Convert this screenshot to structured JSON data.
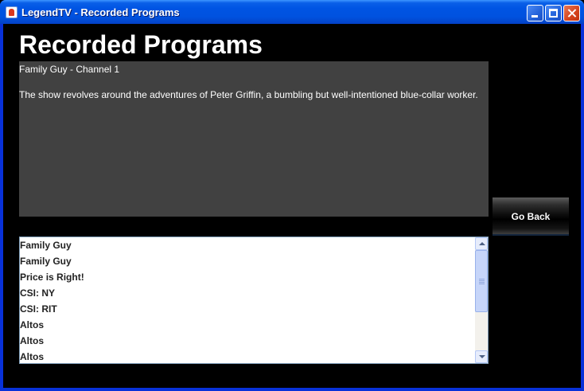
{
  "window": {
    "title": "LegendTV - Recorded Programs",
    "controls": [
      "minimize-icon",
      "maximize-icon",
      "close-icon"
    ]
  },
  "page": {
    "title": "Recorded Programs"
  },
  "details": {
    "heading": "Family Guy - Channel 1",
    "description": "The show revolves around the adventures of Peter Griffin, a bumbling but well-intentioned blue-collar worker."
  },
  "buttons": {
    "go_back": "Go Back"
  },
  "programs": {
    "items": [
      "Family Guy",
      "Family Guy",
      "Price is Right!",
      "CSI: NY",
      "CSI: RIT",
      "Altos",
      "Altos",
      "Altos"
    ]
  },
  "colors": {
    "titlebar": "#0054e3",
    "background": "#000000",
    "details_panel": "#414141",
    "list_background": "#ffffff"
  }
}
